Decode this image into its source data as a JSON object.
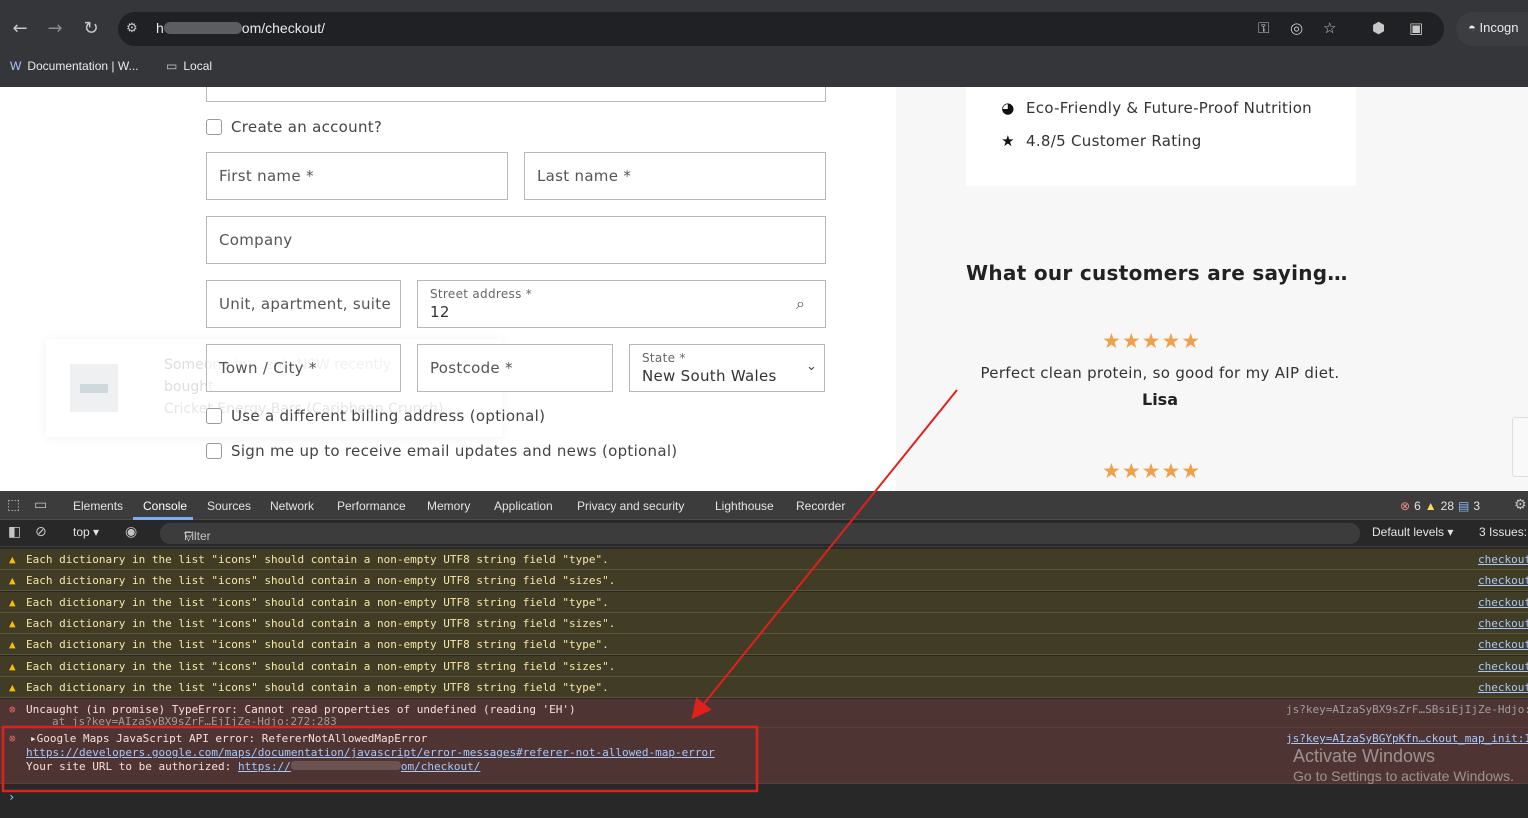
{
  "browser": {
    "url_start": "h",
    "url_end": "om/checkout/",
    "incognito_label": "Incogn",
    "bookmarks": [
      {
        "label": "Documentation | W...",
        "icon": "wordpress-icon"
      },
      {
        "label": "Local",
        "icon": "folder-icon"
      }
    ]
  },
  "form": {
    "create_account": "Create an account?",
    "first_name": "First name *",
    "last_name": "Last name *",
    "company": "Company",
    "unit": "Unit, apartment, suite",
    "street_label": "Street address *",
    "street_value": "12",
    "town": "Town / City *",
    "postcode": "Postcode *",
    "state_label": "State *",
    "state_value": "New South Wales",
    "different_billing": "Use a different billing address (optional)",
    "newsletter": "Sign me up to receive email updates and news (optional)"
  },
  "toast": {
    "line1": "Someone in ...ent, NSW recently",
    "line2": "bought",
    "line3": "Cricket Energy Bars (Caribbean Crunch)",
    "close": "×"
  },
  "sidebar": {
    "features": [
      {
        "label": "Eco-Friendly & Future-Proof Nutrition",
        "icon": "globe-icon"
      },
      {
        "label": "4.8/5 Customer Rating",
        "icon": "star-icon"
      }
    ],
    "testimonials_title": "What our customers are saying…",
    "testimonials": [
      {
        "stars": "★★★★★",
        "quote": "Perfect clean protein, so good for my AIP diet.",
        "author": "Lisa"
      },
      {
        "stars": "★★★★★"
      }
    ]
  },
  "devtools": {
    "tabs": [
      "Elements",
      "Console",
      "Sources",
      "Network",
      "Performance",
      "Memory",
      "Application",
      "Privacy and security",
      "Lighthouse",
      "Recorder"
    ],
    "active_tab": "Console",
    "counts": {
      "errors": "6",
      "warnings": "28",
      "info": "3"
    },
    "context": "top ▾",
    "filter_placeholder": "Filter",
    "levels": "Default levels ▾",
    "issues": "3 Issues:",
    "warnings": [
      "Each dictionary in the list \"icons\" should contain a non-empty UTF8 string field \"type\".",
      "Each dictionary in the list \"icons\" should contain a non-empty UTF8 string field \"sizes\".",
      "Each dictionary in the list \"icons\" should contain a non-empty UTF8 string field \"type\".",
      "Each dictionary in the list \"icons\" should contain a non-empty UTF8 string field \"sizes\".",
      "Each dictionary in the list \"icons\" should contain a non-empty UTF8 string field \"type\".",
      "Each dictionary in the list \"icons\" should contain a non-empty UTF8 string field \"sizes\".",
      "Each dictionary in the list \"icons\" should contain a non-empty UTF8 string field \"type\"."
    ],
    "warning_source": "checkout",
    "error1": {
      "message": "Uncaught (in promise) TypeError: Cannot read properties of undefined (reading 'EH')",
      "stack": "at js?key=AIzaSyBX9sZrF…EjIjZe-Hdjo:272:283",
      "source": "js?key=AIzaSyBX9sZrF…SBsiEjIjZe-Hdjo:"
    },
    "error2": {
      "title": "Google Maps JavaScript API error: RefererNotAllowedMapError",
      "link": "https://developers.google.com/maps/documentation/javascript/error-messages#referer-not-allowed-map-error",
      "site_prefix": "Your site URL to be authorized:",
      "site_start": "https://",
      "site_end": "om/checkout/",
      "source": "js?key=AIzaSyBGYpKfn…ckout_map_init:1"
    },
    "watermark_title": "Activate Windows",
    "watermark_sub": "Go to Settings to activate Windows.",
    "prompt": "›"
  },
  "colors": {
    "annotation": "#e0201b",
    "star": "#f0a04b"
  }
}
